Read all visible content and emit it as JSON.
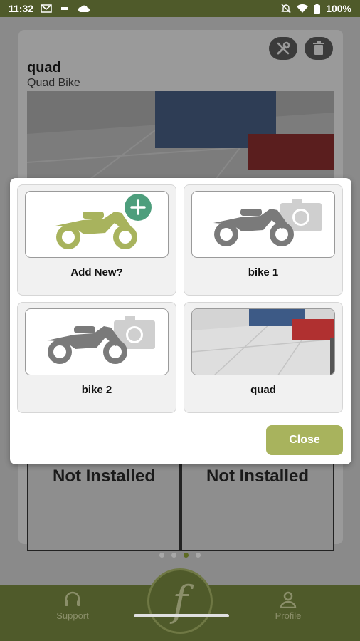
{
  "status_bar": {
    "time": "11:32",
    "battery": "100%",
    "icons": [
      "gmail-icon",
      "sim-icon",
      "cloud-icon",
      "mute-icon",
      "wifi-icon",
      "battery-icon"
    ]
  },
  "vehicle_card": {
    "name": "quad",
    "type": "Quad Bike",
    "tools_icon": "wrench-screwdriver-icon",
    "delete_icon": "trash-icon",
    "cells": [
      "Not Installed",
      "Not Installed"
    ]
  },
  "pager": {
    "count": 4,
    "active_index": 2
  },
  "bottom_nav": {
    "support_label": "Support",
    "profile_label": "Profile",
    "logo_letter": "f"
  },
  "modal": {
    "tiles": [
      {
        "label": "Add New?",
        "image": "add-bike-icon"
      },
      {
        "label": "bike 1",
        "image": "bike-camera-placeholder-icon"
      },
      {
        "label": "bike 2",
        "image": "bike-camera-placeholder-icon"
      },
      {
        "label": "quad",
        "image": "floor-photo"
      }
    ],
    "close_label": "Close"
  },
  "colors": {
    "accent_green": "#a8b35d",
    "add_plus": "#4d9e7c",
    "nav_bg": "#4f5a2a"
  }
}
